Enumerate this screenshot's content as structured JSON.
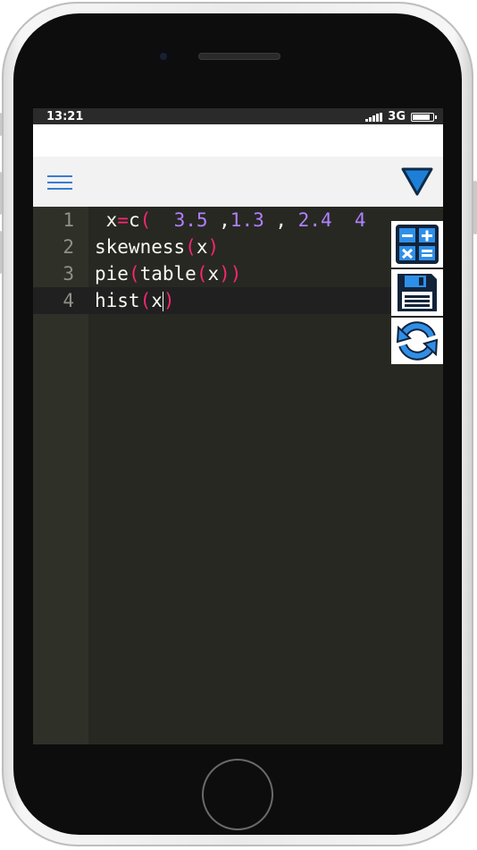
{
  "status_bar": {
    "time": "13:21",
    "network": "3G"
  },
  "toolbar": {
    "menu_icon": "hamburger-menu-icon",
    "dropdown_icon": "triangle-down-icon",
    "accent_color": "#1e7fd6"
  },
  "editor": {
    "lines": [
      {
        "number": "1",
        "tokens": [
          {
            "t": " x",
            "c": "plain"
          },
          {
            "t": "=",
            "c": "kw"
          },
          {
            "t": "c",
            "c": "plain"
          },
          {
            "t": "(",
            "c": "kw"
          },
          {
            "t": "  ",
            "c": "plain"
          },
          {
            "t": "3.5",
            "c": "num"
          },
          {
            "t": " ,",
            "c": "plain"
          },
          {
            "t": "1.3",
            "c": "num"
          },
          {
            "t": " , ",
            "c": "plain"
          },
          {
            "t": "2.4",
            "c": "num"
          },
          {
            "t": "  ",
            "c": "plain"
          },
          {
            "t": "4",
            "c": "num"
          }
        ]
      },
      {
        "number": "2",
        "tokens": [
          {
            "t": "skewness",
            "c": "plain"
          },
          {
            "t": "(",
            "c": "kw"
          },
          {
            "t": "x",
            "c": "plain"
          },
          {
            "t": ")",
            "c": "kw"
          }
        ]
      },
      {
        "number": "3",
        "tokens": [
          {
            "t": "pie",
            "c": "plain"
          },
          {
            "t": "(",
            "c": "kw"
          },
          {
            "t": "table",
            "c": "plain"
          },
          {
            "t": "(",
            "c": "kw"
          },
          {
            "t": "x",
            "c": "plain"
          },
          {
            "t": "))",
            "c": "kw"
          }
        ]
      },
      {
        "number": "4",
        "tokens": [
          {
            "t": "hist",
            "c": "plain"
          },
          {
            "t": "(",
            "c": "kw"
          },
          {
            "t": "x",
            "c": "plain"
          },
          {
            "t": "|",
            "c": "cursor"
          },
          {
            "t": ")",
            "c": "kw"
          }
        ]
      }
    ],
    "active_line": 4
  },
  "actions": [
    {
      "name": "calculator-button",
      "icon": "calculator-icon"
    },
    {
      "name": "save-button",
      "icon": "floppy-disk-icon"
    },
    {
      "name": "refresh-button",
      "icon": "refresh-icon"
    }
  ],
  "colors": {
    "editor_bg": "#272822",
    "keyword": "#f92672",
    "number": "#ae81ff",
    "text": "#f8f8f2",
    "line_number": "#8f908a"
  }
}
